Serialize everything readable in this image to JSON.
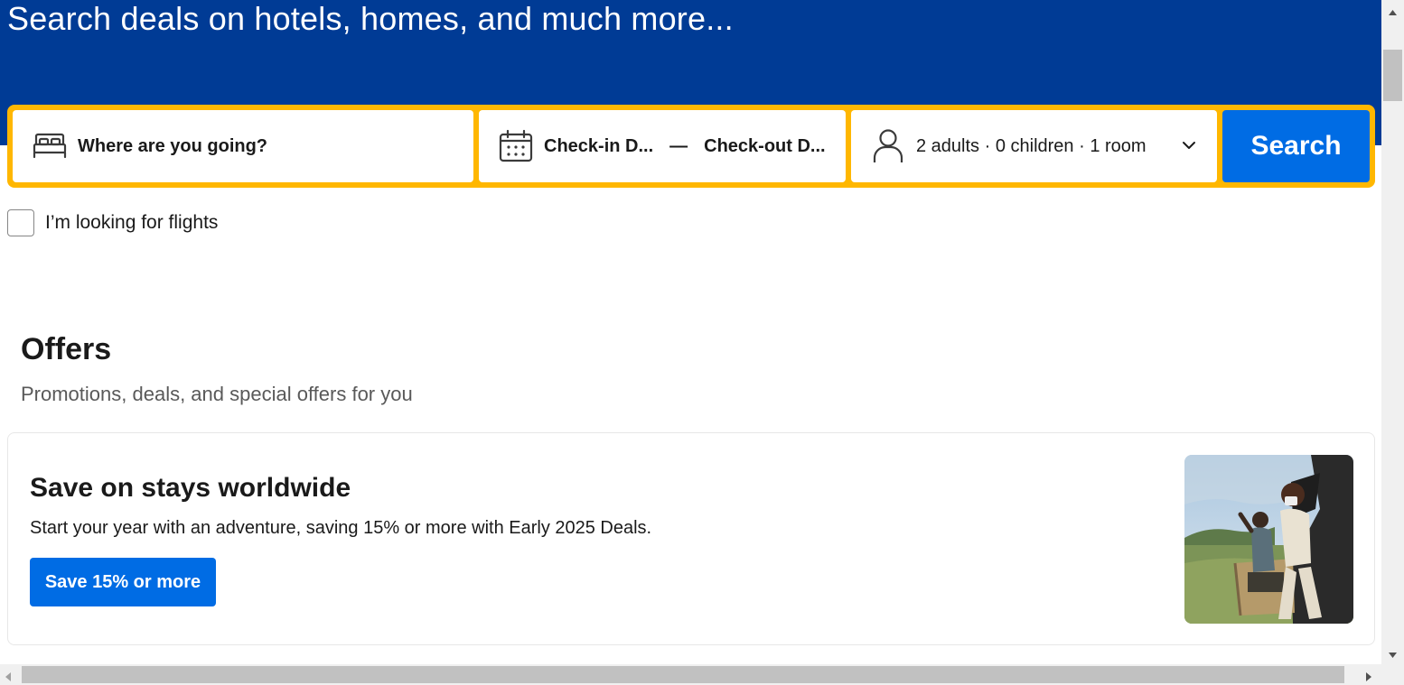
{
  "hero": {
    "title": "Search deals on hotels, homes, and much more...",
    "background_color": "#003b95"
  },
  "search": {
    "destination": {
      "label": "Where are you going?",
      "icon": "bed-icon"
    },
    "dates": {
      "checkin": "Check-in D...",
      "separator": "—",
      "checkout": "Check-out D...",
      "icon": "calendar-icon"
    },
    "guests": {
      "label": "2 adults · 0 children · 1 room",
      "icon": "person-icon"
    },
    "button_label": "Search",
    "border_color": "#ffb700",
    "button_color": "#006ce4"
  },
  "flights": {
    "label": "I’m looking for flights",
    "checked": false
  },
  "offers": {
    "title": "Offers",
    "subtitle": "Promotions, deals, and special offers for you",
    "card": {
      "heading": "Save on stays worldwide",
      "text": "Start your year with an adventure, saving 15% or more with Early 2025 Deals.",
      "button_label": "Save 15% or more",
      "image": "safari-travelers-photo"
    }
  }
}
